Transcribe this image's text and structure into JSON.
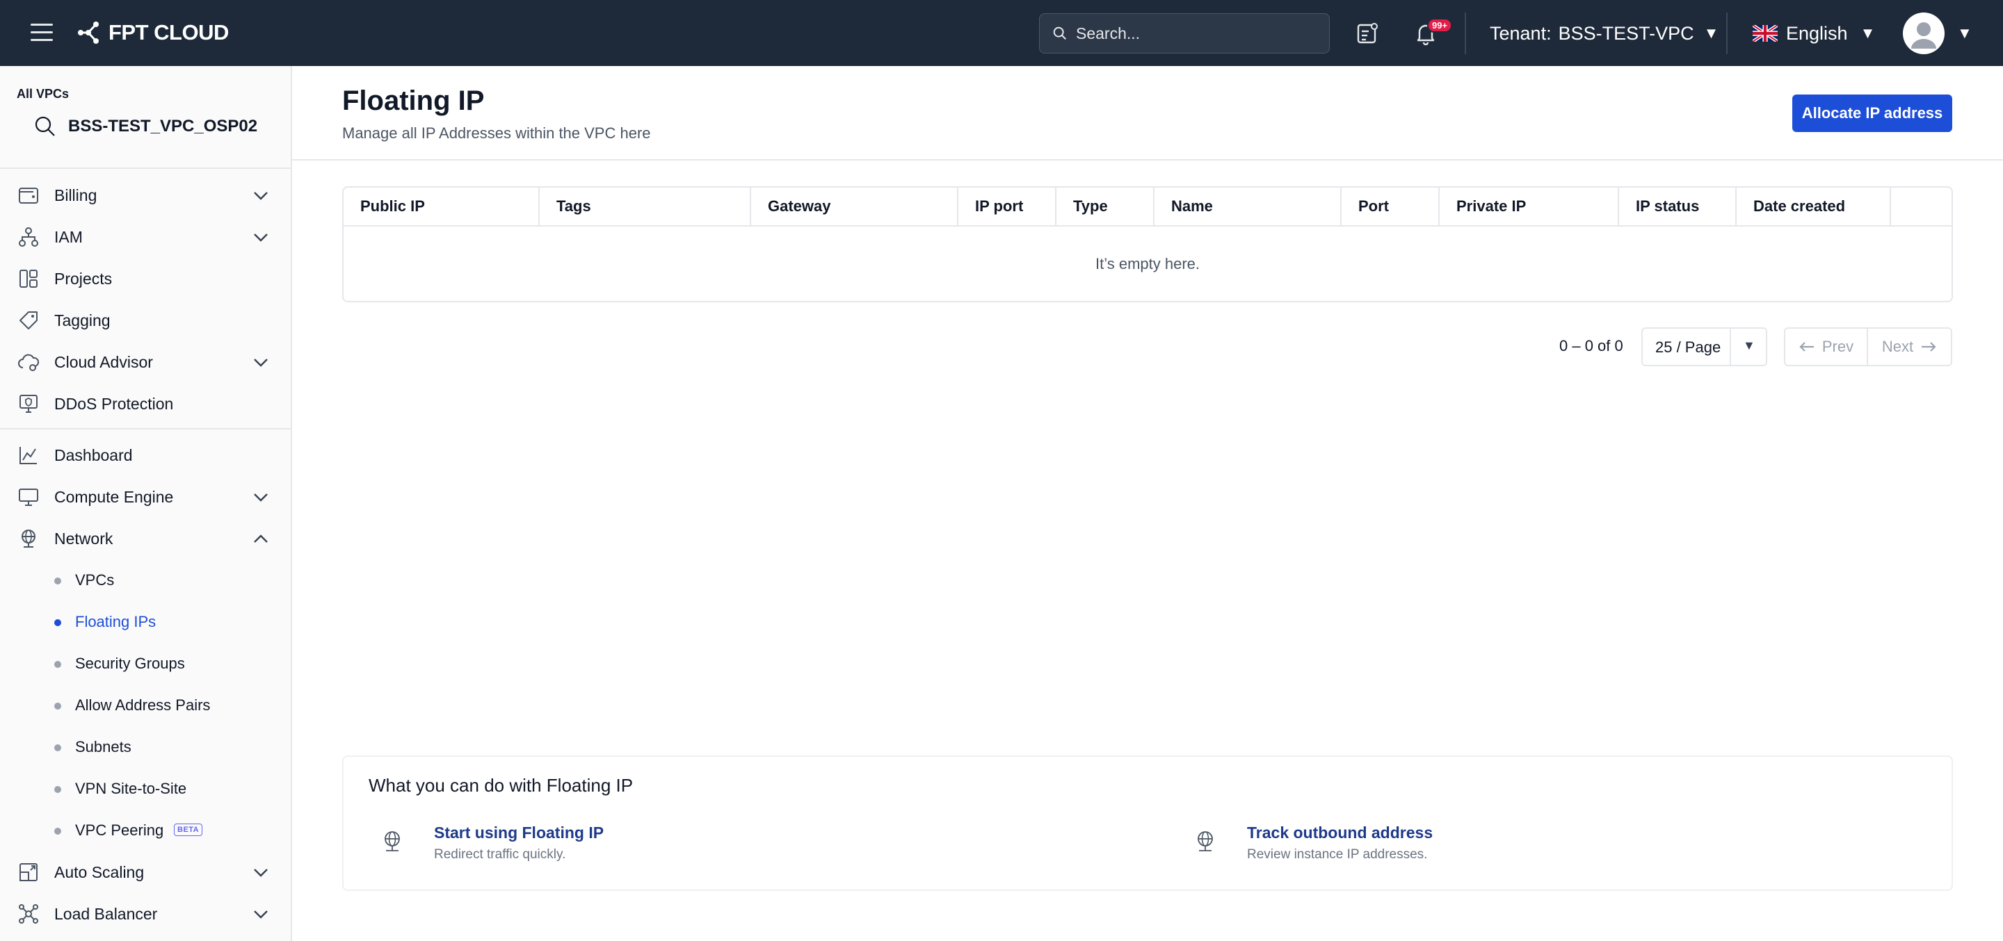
{
  "topbar": {
    "brand": "FPT CLOUD",
    "search_placeholder": "Search...",
    "notification_count": "99+",
    "tenant_label": "Tenant:",
    "tenant_value": "BSS-TEST-VPC",
    "language": "English"
  },
  "sidebar": {
    "vpc_scope_label": "All VPCs",
    "vpc_name": "BSS-TEST_VPC_OSP02",
    "group1": [
      {
        "label": "Billing",
        "icon": "wallet-icon",
        "expandable": true
      },
      {
        "label": "IAM",
        "icon": "hierarchy-icon",
        "expandable": true
      },
      {
        "label": "Projects",
        "icon": "projects-icon",
        "expandable": false
      },
      {
        "label": "Tagging",
        "icon": "tag-icon",
        "expandable": false
      },
      {
        "label": "Cloud Advisor",
        "icon": "cloud-icon",
        "expandable": true
      },
      {
        "label": "DDoS Protection",
        "icon": "shield-monitor-icon",
        "expandable": false
      }
    ],
    "group2": [
      {
        "label": "Dashboard",
        "icon": "chart-line-icon",
        "expandable": false
      },
      {
        "label": "Compute Engine",
        "icon": "monitor-icon",
        "expandable": true
      },
      {
        "label": "Network",
        "icon": "globe-network-icon",
        "expandable": true,
        "expanded": true
      }
    ],
    "network_sub": [
      {
        "label": "VPCs",
        "active": false
      },
      {
        "label": "Floating IPs",
        "active": true
      },
      {
        "label": "Security Groups",
        "active": false
      },
      {
        "label": "Allow Address Pairs",
        "active": false
      },
      {
        "label": "Subnets",
        "active": false
      },
      {
        "label": "VPN Site-to-Site",
        "active": false
      },
      {
        "label": "VPC Peering",
        "active": false,
        "badge": "BETA"
      }
    ],
    "group3": [
      {
        "label": "Auto Scaling",
        "icon": "scaling-icon",
        "expandable": true
      },
      {
        "label": "Load Balancer",
        "icon": "load-balancer-icon",
        "expandable": true
      }
    ]
  },
  "main": {
    "title": "Floating IP",
    "subtitle": "Manage all IP Addresses within the VPC here",
    "allocate_button": "Allocate IP address",
    "table": {
      "columns": [
        "Public IP",
        "Tags",
        "Gateway",
        "IP port",
        "Type",
        "Name",
        "Port",
        "Private IP",
        "IP status",
        "Date created"
      ],
      "empty_text": "It’s empty here."
    },
    "pagination": {
      "range": "0 – 0 of 0",
      "page_size": "25 / Page",
      "prev": "Prev",
      "next": "Next"
    },
    "info": {
      "title": "What you can do with Floating IP",
      "items": [
        {
          "title": "Start using Floating IP",
          "desc": "Redirect traffic quickly."
        },
        {
          "title": "Track outbound address",
          "desc": "Review instance IP addresses."
        }
      ]
    }
  },
  "colors": {
    "topbar_bg": "#1e2a3a",
    "primary": "#1d4ed8",
    "link_dark": "#1e3a8a",
    "badge": "#e11d48"
  }
}
